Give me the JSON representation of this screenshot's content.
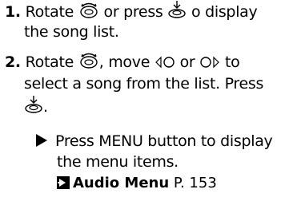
{
  "steps": [
    {
      "number": "1.",
      "line1_a": "Rotate",
      "line1_b": "or press",
      "line1_c": "o display",
      "line2": "the song list."
    },
    {
      "number": "2.",
      "line1_a": "Rotate",
      "line1_b": ", move",
      "line1_c": "or",
      "line1_d": "to",
      "line2": "select a song from the list. Press",
      "line3": "."
    }
  ],
  "note": {
    "line1": "Press MENU button to display",
    "line2": "the menu  items.",
    "xref_title": "Audio Menu",
    "xref_page": "P. 153"
  },
  "icons": [
    "interface-dial-rotate-icon",
    "interface-dial-press-icon",
    "move-left-icon",
    "move-right-icon",
    "note-triangle-icon",
    "cross-reference-arrow-icon"
  ]
}
